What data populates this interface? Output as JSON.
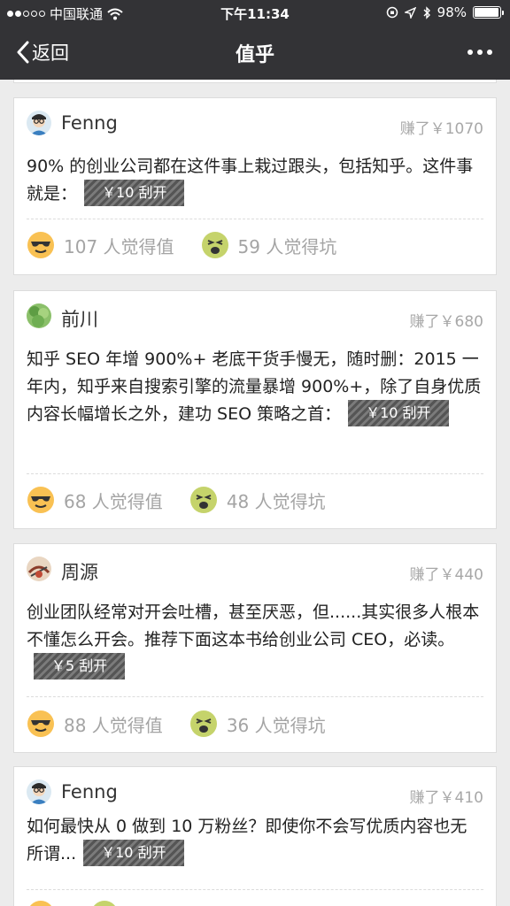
{
  "status_bar": {
    "carrier": "中国联通",
    "time": "下午11:34",
    "battery": "98%",
    "battery_level": 0.98
  },
  "nav": {
    "back_label": "返回",
    "title": "值乎"
  },
  "cards": [
    {
      "author": "Fenng",
      "avatar": "person-glasses-avatar",
      "earned": "赚了￥1070",
      "text": "90% 的创业公司都在这件事上栽过跟头，包括知乎。这件事就是：",
      "reveal_label": "￥10 刮开",
      "worth_count": "107 人觉得值",
      "pit_count": "59 人觉得坑"
    },
    {
      "author": "前川",
      "avatar": "leaf-avatar",
      "earned": "赚了￥680",
      "text": "知乎 SEO 年增 900%+ 老底干货手慢无，随时删：2015 一年内，知乎来自搜索引擎的流量暴增 900%+，除了自身优质内容长幅增长之外，建功 SEO 策略之首：",
      "reveal_label": "￥10 刮开",
      "worth_count": "68 人觉得值",
      "pit_count": "48 人觉得坑"
    },
    {
      "author": "周源",
      "avatar": "sketch-avatar",
      "earned": "赚了￥440",
      "text": "创业团队经常对开会吐槽，甚至厌恶，但......其实很多人根本不懂怎么开会。推荐下面这本书给创业公司 CEO，必读。",
      "reveal_label": "￥5 刮开",
      "worth_count": "88 人觉得值",
      "pit_count": "36 人觉得坑"
    },
    {
      "author": "Fenng",
      "avatar": "person-glasses-avatar",
      "earned": "赚了￥410",
      "text": "如何最快从 0 做到 10 万粉丝？即使你不会写优质内容也无所谓...",
      "reveal_label": "￥10 刮开",
      "worth_count": "",
      "pit_count": ""
    }
  ]
}
